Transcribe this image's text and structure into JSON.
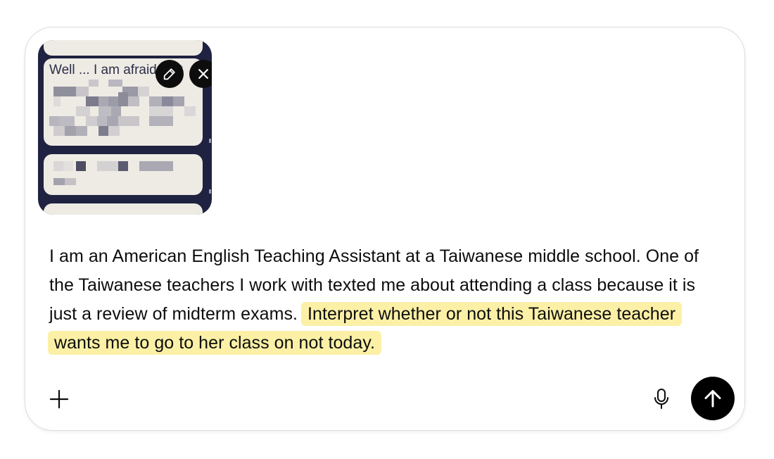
{
  "attachment": {
    "preview_text": "Well ... I am afraid that",
    "edit_icon": "pencil-icon",
    "remove_icon": "close-icon"
  },
  "prompt": {
    "plain_text": "I am an American English Teaching Assistant at a Taiwanese middle school. One of the Taiwanese teachers I work with texted me about attending a class because it is just a review of midterm exams. ",
    "highlighted_text": "Interpret whether or not this Taiwanese teacher wants me to go to her class on not today.",
    "highlight_color": "#fbf0a6"
  },
  "toolbar": {
    "add_icon": "plus-icon",
    "mic_icon": "microphone-icon",
    "send_icon": "arrow-up-icon",
    "send_color": "#000000"
  }
}
